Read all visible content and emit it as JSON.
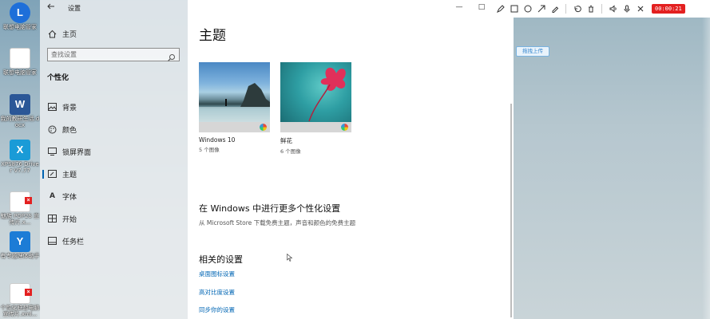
{
  "window": {
    "title": "设置",
    "controls": {
      "minimize": "—",
      "maximize": "□"
    }
  },
  "desktop_icons": [
    {
      "label": "联想电脑管家",
      "glyph": "L",
      "color": "#1e6fd9"
    },
    {
      "label": "联想电脑管家",
      "glyph": "",
      "color": "#ffffff"
    },
    {
      "label": "我的教研生活.docx",
      "glyph": "W",
      "color": "#2b5797"
    },
    {
      "label": "XPS876 Driver V7.77",
      "glyph": "X",
      "color": "#1a9bd7"
    },
    {
      "label": "魅族 POP2S 宣传片.x...",
      "glyph": "",
      "color": "#ffffff"
    },
    {
      "label": "有专题理体助手",
      "glyph": "Y",
      "color": "#1c7cd6"
    },
    {
      "label": "个性化联想电脑宣传片.xml...",
      "glyph": "",
      "color": "#ffffff"
    }
  ],
  "sidebar": {
    "home": "主页",
    "search_placeholder": "查找设置",
    "section": "个性化",
    "items": [
      {
        "label": "背景",
        "icon": "image-icon",
        "active": false
      },
      {
        "label": "颜色",
        "icon": "palette-icon",
        "active": false
      },
      {
        "label": "锁屏界面",
        "icon": "monitor-icon",
        "active": false
      },
      {
        "label": "主题",
        "icon": "brush-icon",
        "active": true
      },
      {
        "label": "字体",
        "icon": "font-icon",
        "active": false
      },
      {
        "label": "开始",
        "icon": "start-grid-icon",
        "active": false
      },
      {
        "label": "任务栏",
        "icon": "taskbar-icon",
        "active": false
      }
    ]
  },
  "main": {
    "title": "主题",
    "themes": [
      {
        "name": "Windows 10",
        "count": "5 个图像"
      },
      {
        "name": "鲜花",
        "count": "6 个图像"
      }
    ],
    "more_heading": "在 Windows 中进行更多个性化设置",
    "more_sub": "从 Microsoft Store 下载免费主题，声音和颜色的免费主题",
    "related_heading": "相关的设置",
    "related_links": [
      "桌面图标设置",
      "高对比度设置",
      "同步你的设置"
    ]
  },
  "recorder": {
    "timer": "00:00:21",
    "tools": [
      "pen-icon",
      "rectangle-icon",
      "circle-icon",
      "arrow-icon",
      "marker-icon",
      "undo-icon",
      "trash-icon",
      "speaker-icon",
      "microphone-icon",
      "close-icon"
    ],
    "drag_upload": "拖拽上传"
  },
  "colors": {
    "accent": "#0063b1",
    "link": "#0066b4",
    "record_red": "#e32020"
  }
}
